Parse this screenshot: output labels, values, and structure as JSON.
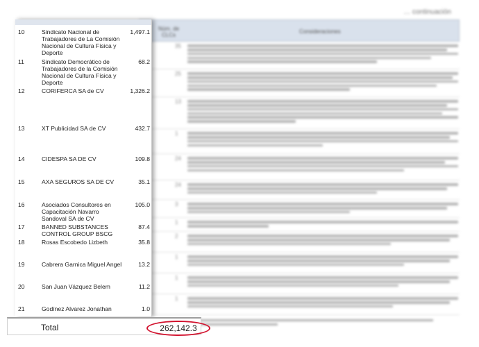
{
  "header_right": "… continuación",
  "bg_table": {
    "col_clcs": "Núm. de CLCs",
    "col_consideraciones": "Consideraciones",
    "row_counts": [
      "35",
      "25",
      "13",
      "1",
      "24",
      "24",
      "3",
      "1",
      "2",
      "1",
      "1",
      "1"
    ]
  },
  "rows": [
    {
      "no": "10",
      "name": "Sindicato Nacional de Trabajadores de La Comisión Nacional de Cultura Física y Deporte",
      "amount": "1,497.1"
    },
    {
      "no": "11",
      "name": "Sindicato Democrático de Trabajadores de la Comisión Nacional de Cultura Física y Deporte",
      "amount": "68.2"
    },
    {
      "no": "12",
      "name": "CORIFERCA SA de CV",
      "amount": "1,326.2"
    },
    {
      "no": "13",
      "name": "XT Publicidad SA de CV",
      "amount": "432.7"
    },
    {
      "no": "14",
      "name": "CIDESPA SA DE CV",
      "amount": "109.8"
    },
    {
      "no": "15",
      "name": "AXA SEGUROS SA DE CV",
      "amount": "35.1"
    },
    {
      "no": "16",
      "name": "Asociados Consultores en Capacitación Navarro Sandoval SA de CV",
      "amount": "105.0"
    },
    {
      "no": "17",
      "name": "BANNED SUBSTANCES CONTROL GROUP BSCG",
      "amount": "87.4"
    },
    {
      "no": "18",
      "name": "Rosas Escobedo Lizbeth",
      "amount": "35.8"
    },
    {
      "no": "19",
      "name": "Cabrera Garnica Miguel Angel",
      "amount": "13.2"
    },
    {
      "no": "20",
      "name": "San Juan Vázquez Belem",
      "amount": "11.2"
    },
    {
      "no": "21",
      "name": "Godínez Alvarez Jonathan",
      "amount": "1.0"
    }
  ],
  "total": {
    "label": "Total",
    "value": "262,142.3"
  },
  "colors": {
    "highlight_circle": "#d2122e",
    "header_bg": "#d9e1ec"
  }
}
